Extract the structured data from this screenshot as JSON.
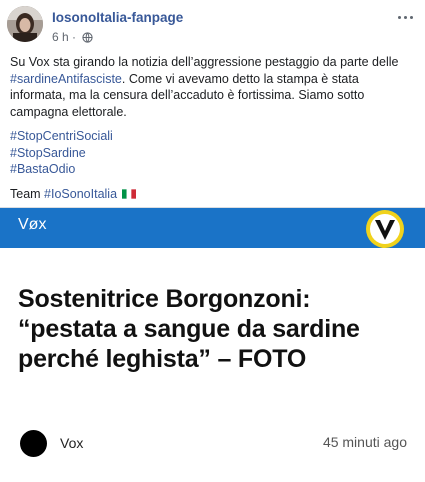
{
  "post": {
    "page_name": "IosonoItalia-fanpage",
    "time": "6 h",
    "separator": "·",
    "text_1": "Su Vox sta girando la notizia dell’aggressione pestaggio da parte delle ",
    "text_hashtag_inline": "#sardineAntifasciste",
    "text_2": ". Come vi avevamo detto la stampa è stata informata, ma la censura dell’accaduto è fortissima. Siamo sotto campagna elettorale.",
    "hashtags": [
      "#StopCentriSociali",
      "#StopSardine",
      "#BastaOdio"
    ],
    "team_label": "Team ",
    "team_hashtag": "#IoSonoItalia"
  },
  "link_preview": {
    "site_name": "Vøx",
    "headline": "Sostenitrice Borgonzoni: “pestata a sangue da sardine perché leghista” – FOTO",
    "author": "Vox",
    "time_ago": "45 minuti ago"
  },
  "colors": {
    "vox_blue": "#1a73c7",
    "link_blue": "#385898",
    "vox_yellow": "#f0d21c"
  },
  "icons": [
    "avatar",
    "globe-icon",
    "more-options-icon",
    "italy-flag-icon",
    "vox-logo-icon"
  ]
}
